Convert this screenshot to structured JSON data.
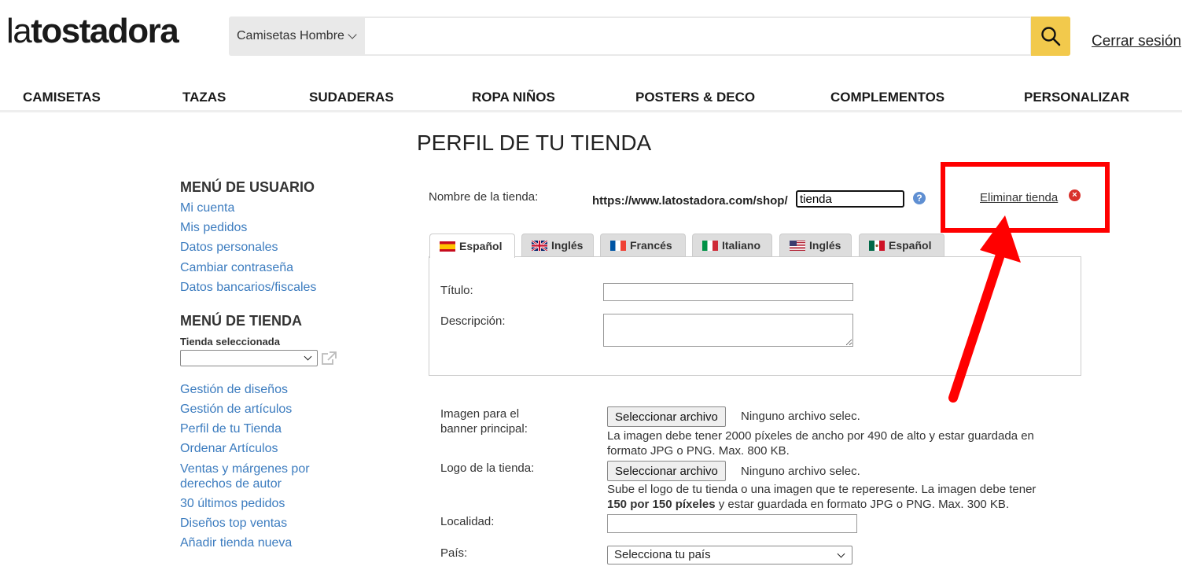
{
  "header": {
    "logo_light": "la",
    "logo_bold": "tostadora",
    "category_select": "Camisetas Hombre",
    "search_placeholder": "",
    "logout": "Cerrar sesión"
  },
  "nav": [
    "CAMISETAS",
    "TAZAS",
    "SUDADERAS",
    "ROPA NIÑOS",
    "POSTERS & DECO",
    "COMPLEMENTOS",
    "PERSONALIZAR"
  ],
  "user_menu": {
    "title": "MENÚ DE USUARIO",
    "items": [
      "Mi cuenta",
      "Mis pedidos",
      "Datos personales",
      "Cambiar contraseña",
      "Datos bancarios/fiscales"
    ]
  },
  "shop_menu": {
    "title": "MENÚ DE TIENDA",
    "selected_label": "Tienda seleccionada",
    "selected_value": "",
    "items": [
      "Gestión de diseños",
      "Gestión de artículos",
      "Perfil de tu Tienda",
      "Ordenar Artículos",
      "Ventas y márgenes por",
      "derechos de autor",
      "30 últimos pedidos",
      "Diseños top ventas",
      "Añadir tienda nueva"
    ]
  },
  "main": {
    "title": "PERFIL DE TU TIENDA",
    "shop_name_label": "Nombre de la tienda:",
    "shop_url_prefix": "https://www.latostadora.com/shop/",
    "shop_name_value": "tienda",
    "help_icon": "?",
    "delete_label": "Eliminar tienda",
    "delete_icon": "x-circle-icon",
    "tabs": [
      {
        "label": "Español",
        "flag": "es"
      },
      {
        "label": "Inglés",
        "flag": "gb"
      },
      {
        "label": "Francés",
        "flag": "fr"
      },
      {
        "label": "Italiano",
        "flag": "it"
      },
      {
        "label": "Inglés",
        "flag": "us"
      },
      {
        "label": "Español",
        "flag": "mx"
      }
    ],
    "title_label": "Título:",
    "description_label": "Descripción:",
    "banner_label_1": "Imagen para el",
    "banner_label_2": "banner principal:",
    "file_button": "Seleccionar archivo",
    "no_file": "Ninguno archivo selec.",
    "banner_hint_1": "La imagen debe tener 2000 píxeles de ancho por 490 de alto y estar guardada en",
    "banner_hint_2": "formato JPG o PNG. Max. 800 KB.",
    "logo_label": "Logo de la tienda:",
    "logo_hint_1": "Sube el logo de tu tienda o una imagen que te reperesente. La imagen debe tener",
    "logo_hint_2_bold": "150 por 150 píxeles",
    "logo_hint_2_rest": " y estar guardada en formato JPG o PNG. Max. 300 KB.",
    "locality_label": "Localidad:",
    "country_label": "País:",
    "country_select": "Selecciona tu país"
  },
  "colors": {
    "accent": "#f2c94c",
    "link": "#3c7cbf",
    "highlight": "#ff0000"
  }
}
